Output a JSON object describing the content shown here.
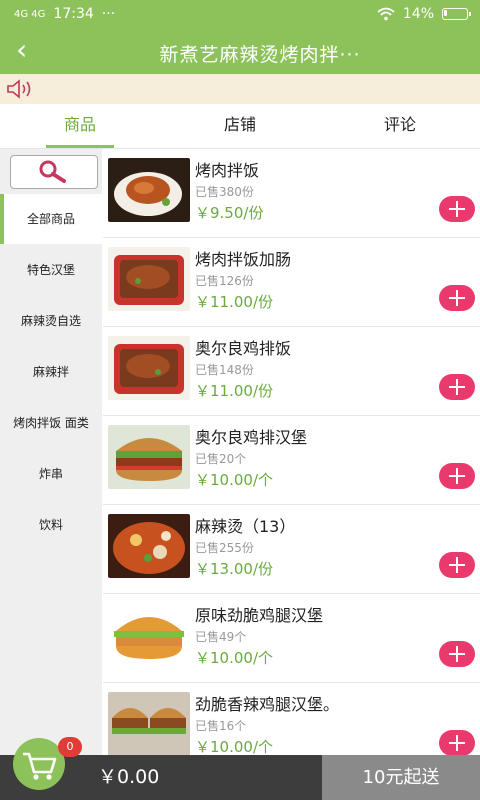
{
  "status_bar": {
    "network": "4G 4G",
    "time": "17:34",
    "more": "···",
    "battery": "14%",
    "battery_level": 0.14
  },
  "header": {
    "back_icon": "‹",
    "title": "新煮艺麻辣烫烤肉拌···"
  },
  "notice": {
    "icon": "speaker-icon",
    "text": ""
  },
  "tabs": [
    {
      "label": "商品",
      "active": true
    },
    {
      "label": "店铺"
    },
    {
      "label": "评论"
    }
  ],
  "sidebar": {
    "search_icon": "search-icon",
    "categories": [
      {
        "label": "全部商品",
        "active": true
      },
      {
        "label": "特色汉堡"
      },
      {
        "label": "麻辣烫自选"
      },
      {
        "label": "麻辣拌"
      },
      {
        "label": "烤肉拌饭 面类"
      },
      {
        "label": "炸串"
      },
      {
        "label": "饮料"
      }
    ]
  },
  "products": [
    {
      "name": "烤肉拌饭",
      "sold": "已售380份",
      "price": "￥9.50/份"
    },
    {
      "name": "烤肉拌饭加肠",
      "sold": "已售126份",
      "price": "￥11.00/份"
    },
    {
      "name": "奥尔良鸡排饭",
      "sold": "已售148份",
      "price": "￥11.00/份"
    },
    {
      "name": "奥尔良鸡排汉堡",
      "sold": "已售20个",
      "price": "￥10.00/个"
    },
    {
      "name": "麻辣烫（13）",
      "sold": "已售255份",
      "price": "￥13.00/份"
    },
    {
      "name": "原味劲脆鸡腿汉堡",
      "sold": "已售49个",
      "price": "￥10.00/个"
    },
    {
      "name": "劲脆香辣鸡腿汉堡。",
      "sold": "已售16个",
      "price": "￥10.00/个"
    }
  ],
  "cart": {
    "count": "0",
    "total": "￥0.00",
    "min_order": "10元起送"
  },
  "colors": {
    "brand": "#8dc25b",
    "price": "#6aab3c",
    "add": "#e9396d",
    "footer": "#3d3d3d"
  }
}
